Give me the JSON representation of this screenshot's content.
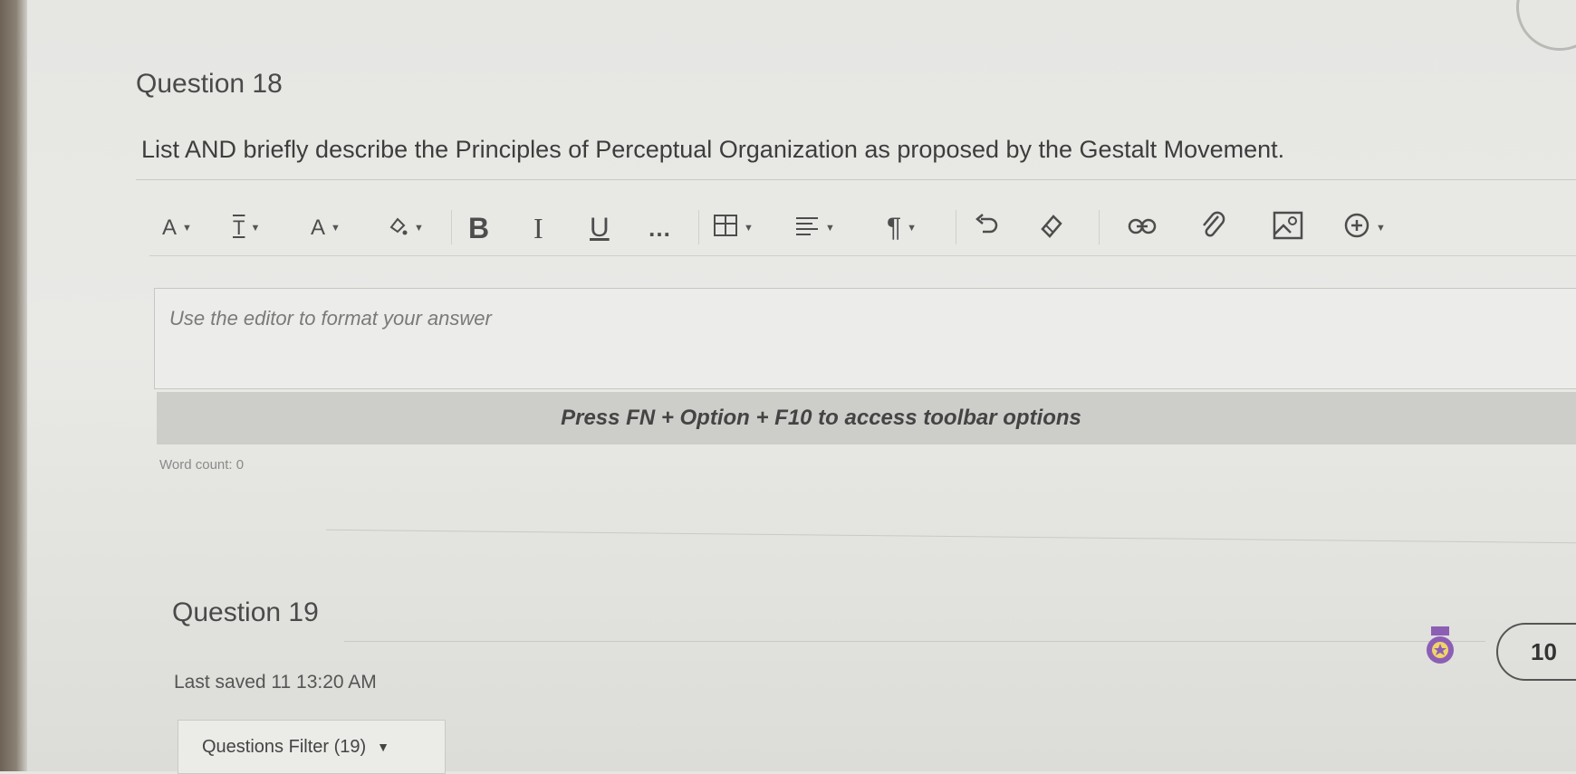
{
  "question18": {
    "title": "Question 18",
    "prompt": "List AND briefly describe the Principles of Perceptual Organization as proposed by the Gestalt Movement."
  },
  "toolbar": {
    "bold": "B",
    "italic": "I",
    "underline": "U",
    "more": "…",
    "paragraph": "¶",
    "icons": [
      "text-format-icon",
      "text-style-icon",
      "font-size-icon",
      "text-color-icon",
      "bold-icon",
      "italic-icon",
      "underline-icon",
      "more-icon",
      "table-icon",
      "align-icon",
      "paragraph-icon",
      "undo-icon",
      "eraser-icon",
      "link-icon",
      "attach-icon",
      "image-icon",
      "insert-plus-icon"
    ]
  },
  "editor": {
    "placeholder": "Use the editor to format your answer",
    "hint": "Press FN + Option + F10 to access toolbar options",
    "word_count": "Word count: 0"
  },
  "question19": {
    "title": "Question 19"
  },
  "footer": {
    "last_saved": "Last saved 11 13:20 AM",
    "filter_label": "Questions Filter (19)",
    "counter": "10"
  },
  "colors": {
    "background": "#e6e6e3",
    "hint_bar": "#cdcdca",
    "badge": "#8c5fb5"
  }
}
